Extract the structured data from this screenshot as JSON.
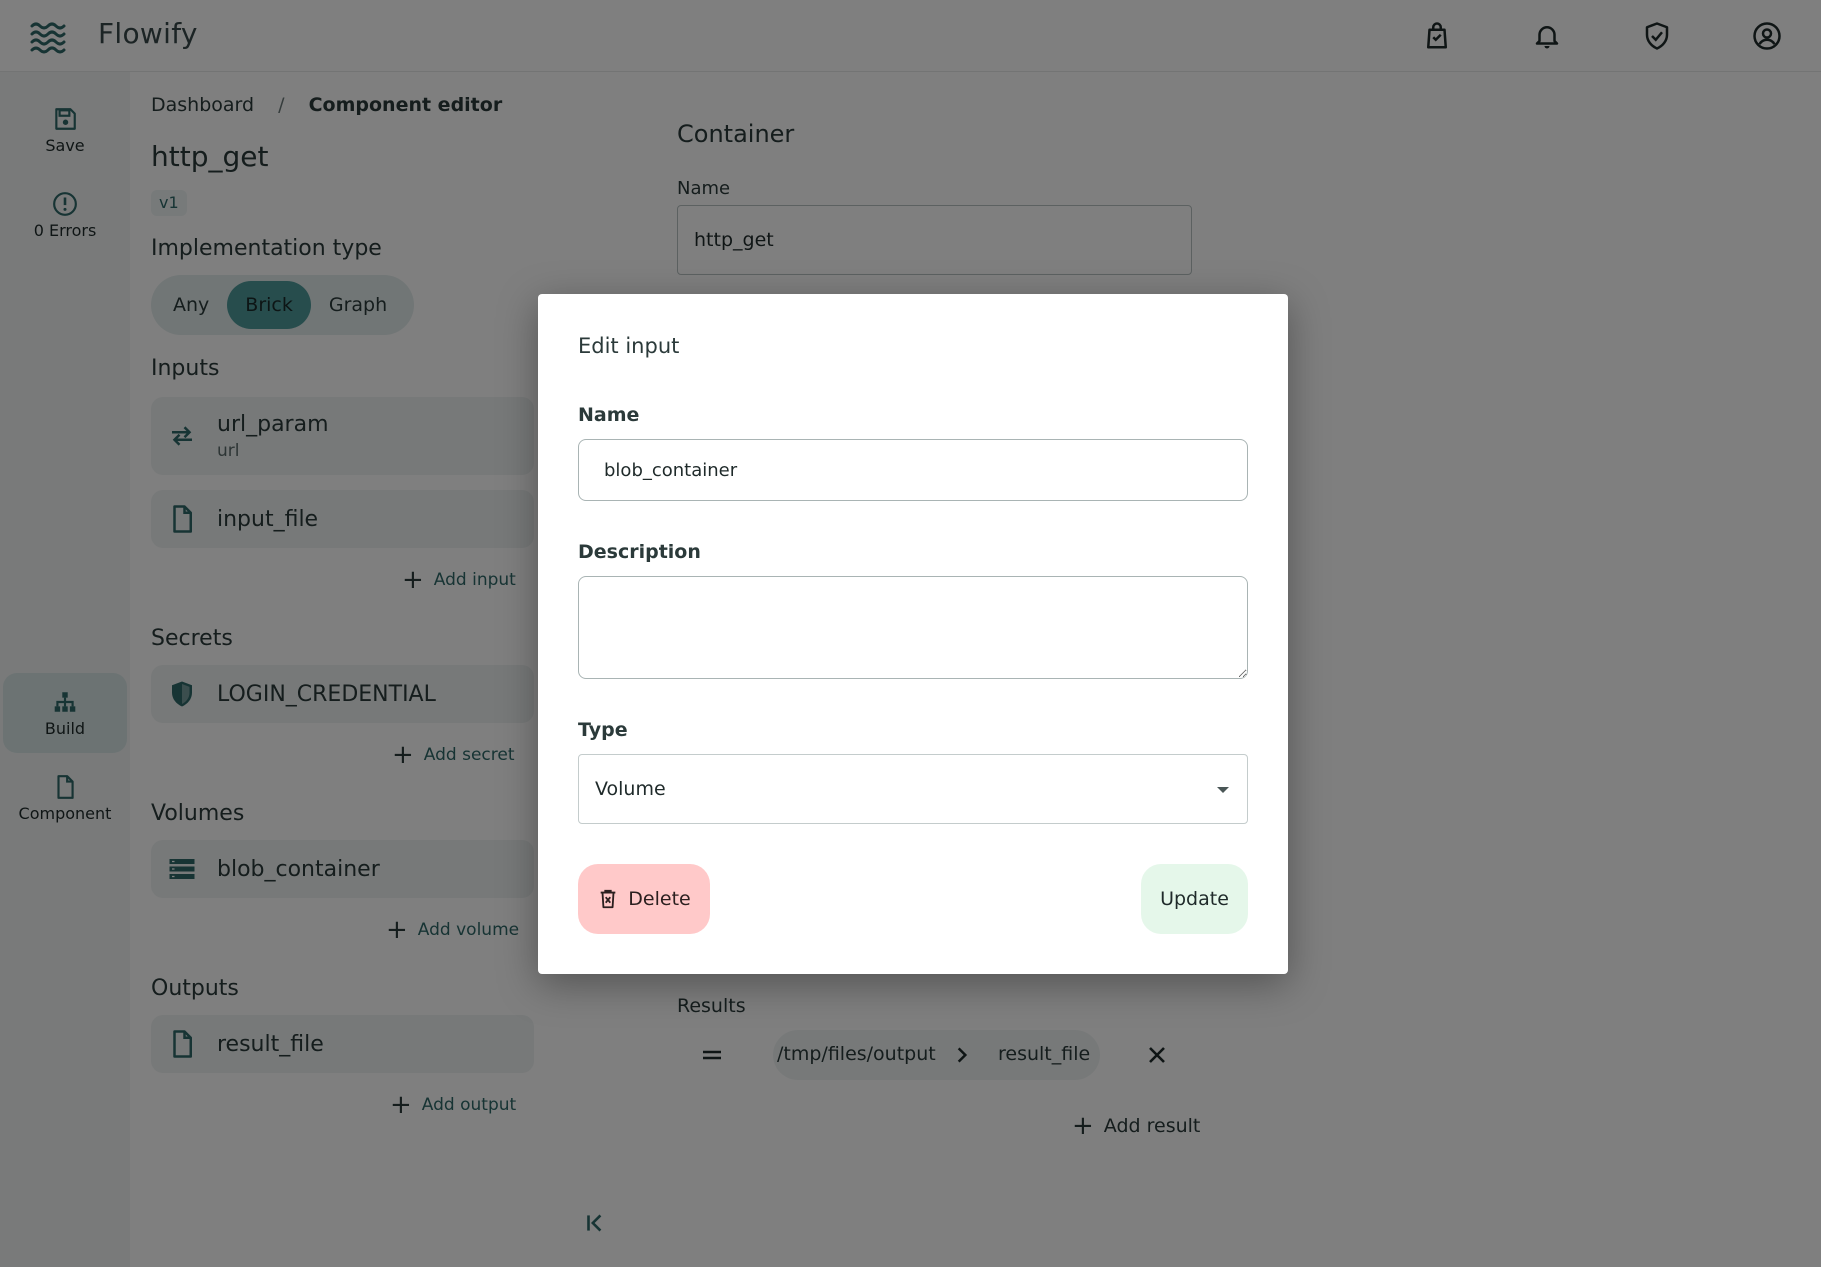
{
  "app": {
    "name": "Flowify",
    "logo_icon": "waves-icon"
  },
  "topbar": {
    "icons": [
      "shopping-bag-icon",
      "bell-icon",
      "shield-check-icon",
      "account-circle-icon"
    ]
  },
  "rail": {
    "save_label": "Save",
    "errors_label": "0 Errors",
    "build_label": "Build",
    "component_label": "Component"
  },
  "breadcrumb": {
    "root": "Dashboard",
    "separator": "/",
    "current": "Component editor"
  },
  "component": {
    "name": "http_get",
    "version": "v1"
  },
  "implementation": {
    "title": "Implementation type",
    "options": [
      "Any",
      "Brick",
      "Graph"
    ],
    "selected": "Brick"
  },
  "inputs": {
    "title": "Inputs",
    "items": [
      {
        "name": "url_param",
        "sub": "url",
        "icon": "swap-icon"
      },
      {
        "name": "input_file",
        "sub": "",
        "icon": "file-icon"
      }
    ],
    "add_label": "Add input"
  },
  "secrets": {
    "title": "Secrets",
    "items": [
      {
        "name": "LOGIN_CREDENTIAL",
        "icon": "shield-icon"
      }
    ],
    "add_label": "Add secret"
  },
  "volumes": {
    "title": "Volumes",
    "items": [
      {
        "name": "blob_container",
        "icon": "storage-icon"
      }
    ],
    "add_label": "Add volume"
  },
  "outputs": {
    "title": "Outputs",
    "items": [
      {
        "name": "result_file",
        "icon": "file-icon"
      }
    ],
    "add_label": "Add output"
  },
  "container": {
    "title": "Container",
    "name_label": "Name",
    "name_value": "http_get"
  },
  "results": {
    "title": "Results",
    "path": "/tmp/files/output",
    "target": "result_file",
    "add_label": "Add result"
  },
  "modal": {
    "title": "Edit input",
    "name_label": "Name",
    "name_value": "blob_container",
    "description_label": "Description",
    "description_value": "",
    "type_label": "Type",
    "type_value": "Volume",
    "delete_label": "Delete",
    "update_label": "Update"
  },
  "colors": {
    "accent": "#2e6868",
    "selected_segment": "#4f9a9a",
    "delete_bg": "#ffc9c9",
    "update_bg": "#e5f7ea",
    "overlay": "rgba(0,0,0,0.5)"
  }
}
